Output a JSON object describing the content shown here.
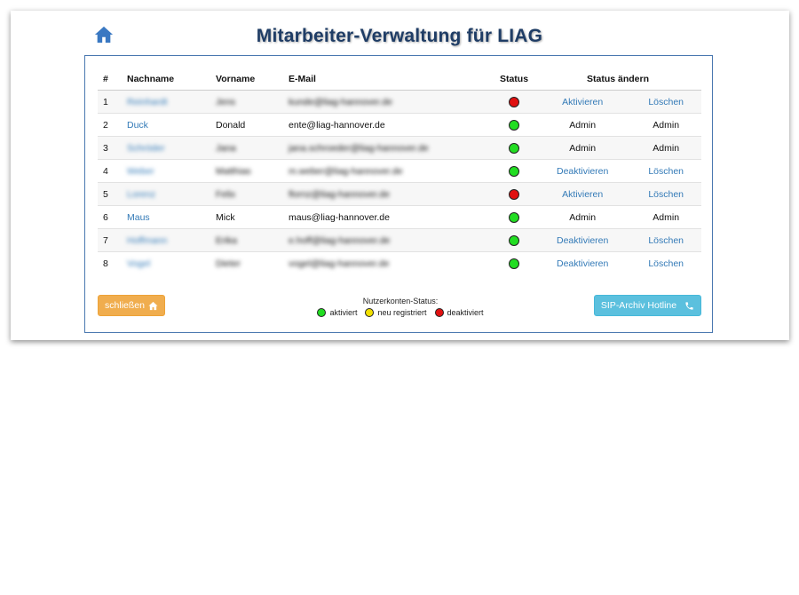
{
  "page": {
    "title": "Mitarbeiter-Verwaltung für LIAG"
  },
  "table": {
    "headers": {
      "num": "#",
      "lastname": "Nachname",
      "firstname": "Vorname",
      "email": "E-Mail",
      "status": "Status",
      "status_change": "Status ändern"
    },
    "rows": [
      {
        "num": "1",
        "lastname": "Reinhardt",
        "firstname": "Jens",
        "email": "kunde@liag-hannover.de",
        "status": "deaktiviert",
        "action1": "Aktivieren",
        "action2": "Löschen",
        "blurred": true
      },
      {
        "num": "2",
        "lastname": "Duck",
        "firstname": "Donald",
        "email": "ente@liag-hannover.de",
        "status": "aktiviert",
        "action1": "Admin",
        "action2": "Admin",
        "blurred": false
      },
      {
        "num": "3",
        "lastname": "Schröder",
        "firstname": "Jana",
        "email": "jana.schroeder@liag-hannover.de",
        "status": "aktiviert",
        "action1": "Admin",
        "action2": "Admin",
        "blurred": true
      },
      {
        "num": "4",
        "lastname": "Weber",
        "firstname": "Matthias",
        "email": "m.weber@liag-hannover.de",
        "status": "aktiviert",
        "action1": "Deaktivieren",
        "action2": "Löschen",
        "blurred": true
      },
      {
        "num": "5",
        "lastname": "Lorenz",
        "firstname": "Felix",
        "email": "flornz@liag-hannover.de",
        "status": "deaktiviert",
        "action1": "Aktivieren",
        "action2": "Löschen",
        "blurred": true
      },
      {
        "num": "6",
        "lastname": "Maus",
        "firstname": "Mick",
        "email": "maus@liag-hannover.de",
        "status": "aktiviert",
        "action1": "Admin",
        "action2": "Admin",
        "blurred": false
      },
      {
        "num": "7",
        "lastname": "Hoffmann",
        "firstname": "Erika",
        "email": "e.hoff@liag-hannover.de",
        "status": "aktiviert",
        "action1": "Deaktivieren",
        "action2": "Löschen",
        "blurred": true
      },
      {
        "num": "8",
        "lastname": "Vogel",
        "firstname": "Dieter",
        "email": "vogel@liag-hannover.de",
        "status": "aktiviert",
        "action1": "Deaktivieren",
        "action2": "Löschen",
        "blurred": true
      }
    ]
  },
  "legend": {
    "title": "Nutzerkonten-Status:",
    "items": [
      {
        "label": "aktiviert",
        "color": "#22dd22"
      },
      {
        "label": "neu registriert",
        "color": "#f2e000"
      },
      {
        "label": "deaktiviert",
        "color": "#e01010"
      }
    ]
  },
  "buttons": {
    "close_label": "schließen",
    "sip_label": "SIP-Archiv Hotline"
  },
  "colors": {
    "title": "#1f3d66",
    "link": "#337ab7",
    "close_button": "#f0ad4e",
    "sip_button": "#5bc0de",
    "status_active": "#22dd22",
    "status_new": "#f2e000",
    "status_inactive": "#e01010"
  },
  "icons": {
    "top_home": "home-icon",
    "close_home": "home-icon",
    "sip_phone": "phone-icon"
  }
}
